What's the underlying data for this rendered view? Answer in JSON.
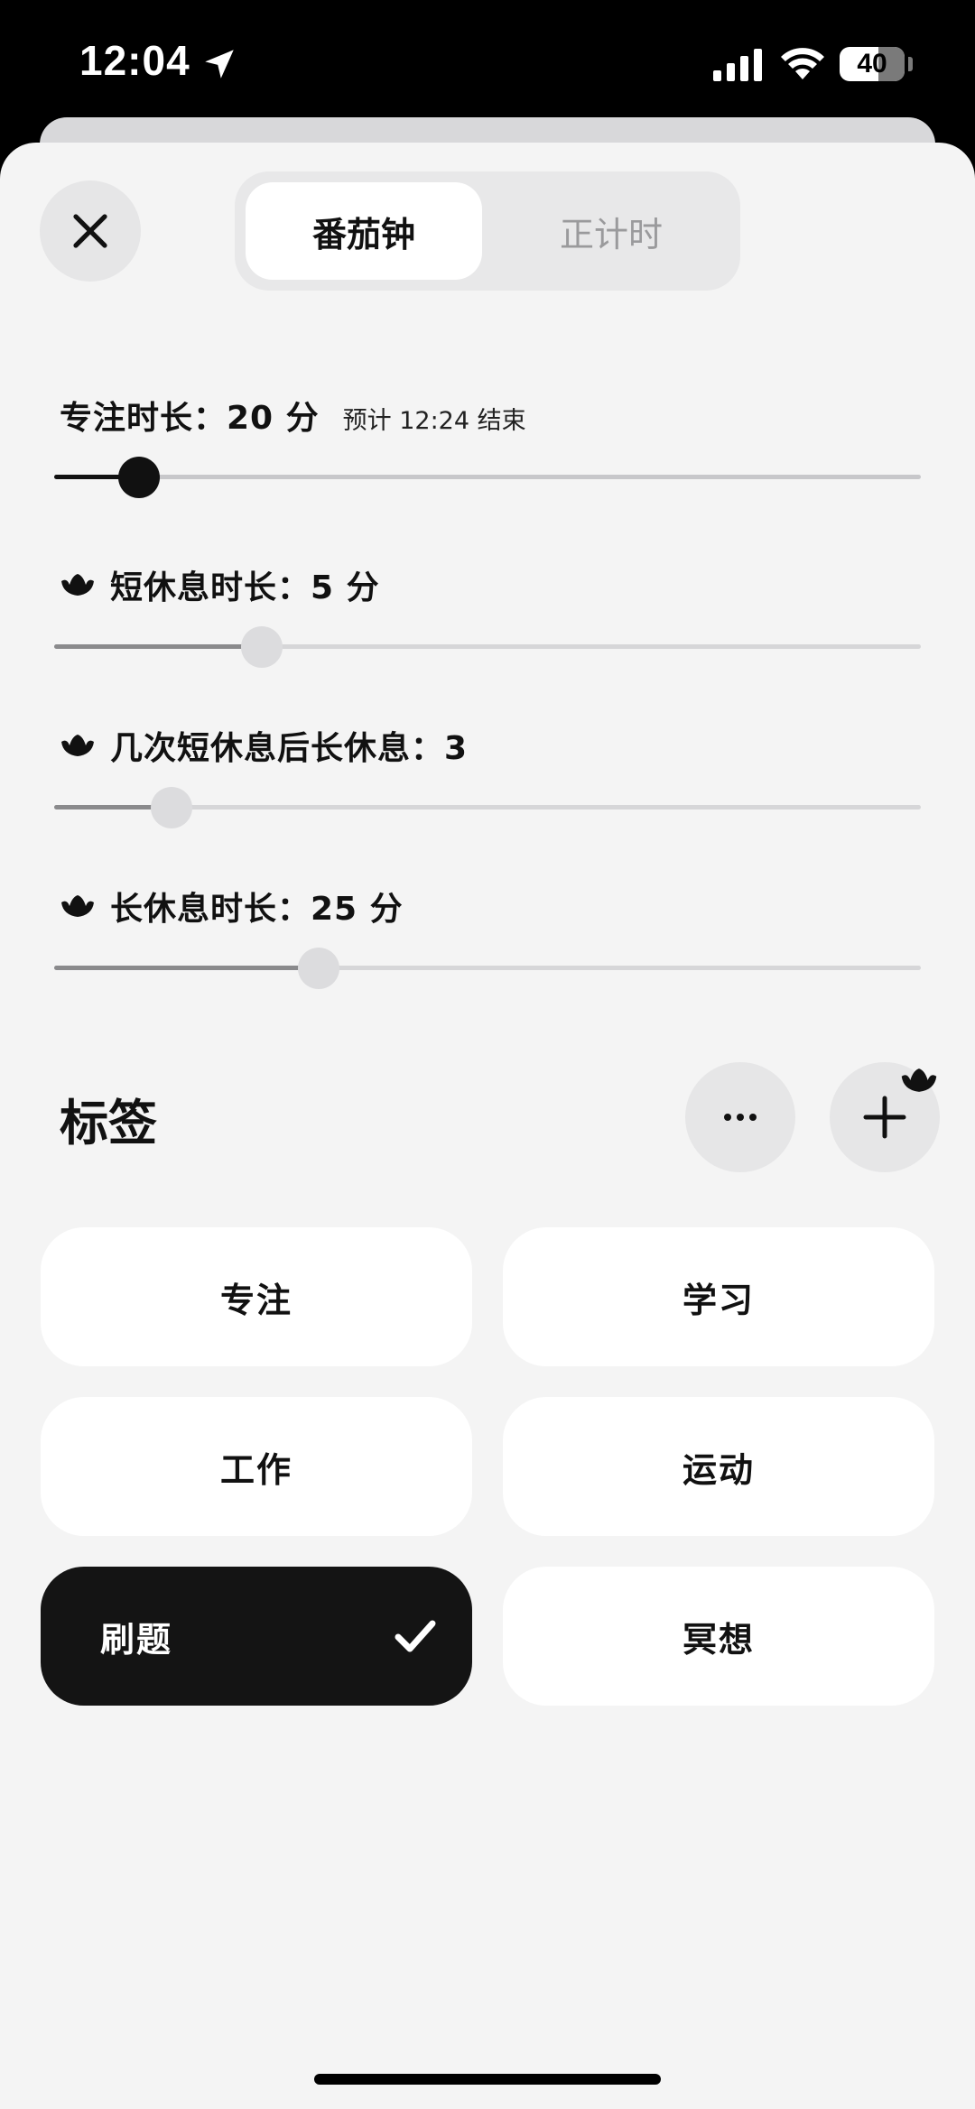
{
  "status_bar": {
    "time": "12:04",
    "battery_level": "40"
  },
  "mode_switch": {
    "options": [
      "番茄钟",
      "正计时"
    ],
    "selected": "番茄钟"
  },
  "settings": {
    "focus": {
      "label": "专注时长：20 分",
      "hint": "预计 12:24 结束",
      "value": 20,
      "fill_fraction": 0.098
    },
    "short_break": {
      "label": "短休息时长：5 分",
      "value": 5,
      "fill_fraction": 0.24
    },
    "long_break_interval": {
      "label": "几次短休息后长休息：3",
      "value": 3,
      "fill_fraction": 0.135
    },
    "long_break": {
      "label": "长休息时长：25 分",
      "value": 25,
      "fill_fraction": 0.305
    }
  },
  "tags": {
    "title": "标签",
    "items": [
      {
        "label": "专注",
        "selected": false
      },
      {
        "label": "学习",
        "selected": false
      },
      {
        "label": "工作",
        "selected": false
      },
      {
        "label": "运动",
        "selected": false
      },
      {
        "label": "刷题",
        "selected": true
      },
      {
        "label": "冥想",
        "selected": false
      }
    ]
  },
  "icons": {
    "close": "close-icon",
    "more": "more-icon",
    "add": "plus-icon",
    "premium": "crown-icon",
    "check": "checkmark-icon"
  },
  "colors": {
    "accent": "#141414",
    "sheet_background": "#f4f4f4",
    "button_background": "#e6e6e7"
  }
}
